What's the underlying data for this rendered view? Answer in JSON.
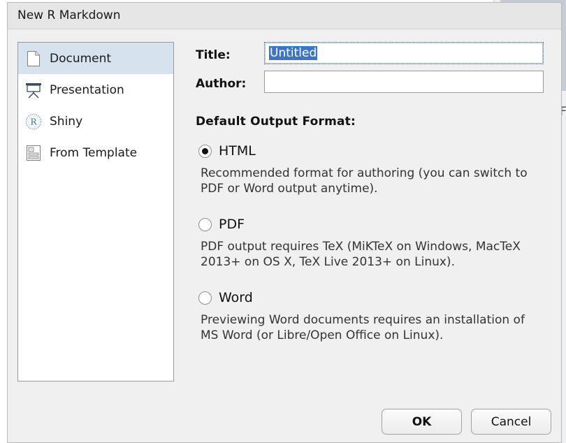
{
  "dialog": {
    "title": "New R Markdown"
  },
  "sidebar": {
    "items": [
      {
        "label": "Document",
        "icon": "document-icon",
        "selected": true
      },
      {
        "label": "Presentation",
        "icon": "presentation-icon",
        "selected": false
      },
      {
        "label": "Shiny",
        "icon": "shiny-icon",
        "selected": false
      },
      {
        "label": "From Template",
        "icon": "template-icon",
        "selected": false
      }
    ]
  },
  "form": {
    "title_label": "Title:",
    "title_value": "Untitled",
    "author_label": "Author:",
    "author_value": ""
  },
  "output_format": {
    "header": "Default Output Format:",
    "selected": "HTML",
    "options": [
      {
        "label": "HTML",
        "description": "Recommended format for authoring (you can switch to PDF or Word output anytime)."
      },
      {
        "label": "PDF",
        "description": "PDF output requires TeX (MiKTeX on Windows, MacTeX 2013+ on OS X, TeX Live 2013+ on Linux)."
      },
      {
        "label": "Word",
        "description": "Previewing Word documents requires an installation of MS Word (or Libre/Open Office on Linux)."
      }
    ]
  },
  "buttons": {
    "ok_label": "OK",
    "cancel_label": "Cancel"
  },
  "background": {
    "partial_letter": "F"
  },
  "colors": {
    "selected_row": "#d6e3ef",
    "text_selection": "#3d75c4",
    "dialog_bg": "#f0f0f0"
  }
}
